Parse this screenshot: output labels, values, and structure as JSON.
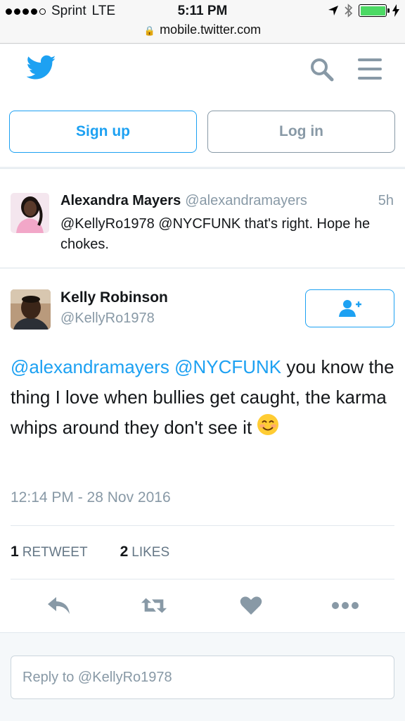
{
  "status_bar": {
    "carrier": "Sprint",
    "network": "LTE",
    "time": "5:11 PM",
    "url": "mobile.twitter.com",
    "battery_level": 1.0,
    "battery_color": "#4cd964"
  },
  "header": {
    "logo_icon": "twitter-bird-icon",
    "signup_label": "Sign up",
    "login_label": "Log in"
  },
  "parent_tweet": {
    "name": "Alexandra Mayers",
    "handle": "@alexandramayers",
    "time_ago": "5h",
    "text": "@KellyRo1978 @NYCFUNK  that's right. Hope he chokes."
  },
  "main_tweet": {
    "name": "Kelly Robinson",
    "handle": "@KellyRo1978",
    "mention1": "@alexandramayers",
    "mention2": "@NYCFUNK",
    "text": " you know the thing  I love when bullies get caught, the karma whips around they don't see it ",
    "emoji": "smiling-face-emoji",
    "timestamp": "12:14 PM - 28 Nov 2016",
    "retweet_count": "1",
    "retweet_label": "RETWEET",
    "likes_count": "2",
    "likes_label": "LIKES"
  },
  "reply": {
    "placeholder": "Reply to @KellyRo1978"
  },
  "colors": {
    "accent": "#1da1f2",
    "muted": "#8899a6",
    "icon_gray": "#8899a6"
  }
}
